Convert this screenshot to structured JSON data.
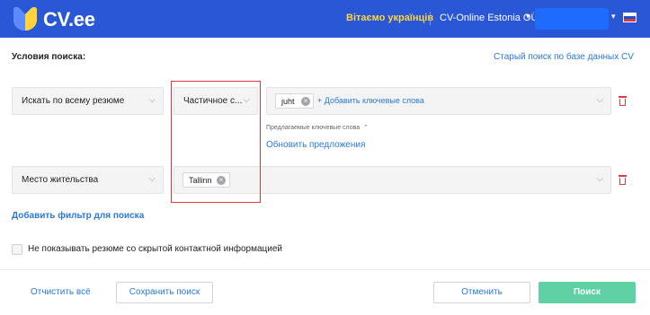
{
  "header": {
    "brand": "CV.ee",
    "ukraine_text": "Вітаємо українців",
    "company": "CV-Online Estonia OÜ",
    "user_color": "#1d6bff",
    "accent": "#2a57d6",
    "flag": "russian-flag-icon"
  },
  "search_conditions": {
    "title": "Условия поиска:",
    "old_search_link": "Старый поиск по базе данных CV"
  },
  "filters": [
    {
      "field": "Искать по всему резюме",
      "match": "Частичное с...",
      "keywords": [
        "juht"
      ],
      "add_keywords": "+ Добавить ключевые слова"
    },
    {
      "field": "Место жительства",
      "values": [
        "Tallinn"
      ]
    }
  ],
  "suggestions": {
    "label": "Предлагаемые ключевые слова",
    "refresh": "Обновить предложения"
  },
  "add_filter": "Добавить фильтр для поиска",
  "hide_contact": {
    "label": "Не показывать резюме со скрытой контактной информацией",
    "checked": false
  },
  "footer": {
    "clear_all": "Отчистить всё",
    "save_search": "Сохранить поиск",
    "cancel": "Отменить",
    "search": "Поиск",
    "search_color": "#5fd1a5"
  }
}
